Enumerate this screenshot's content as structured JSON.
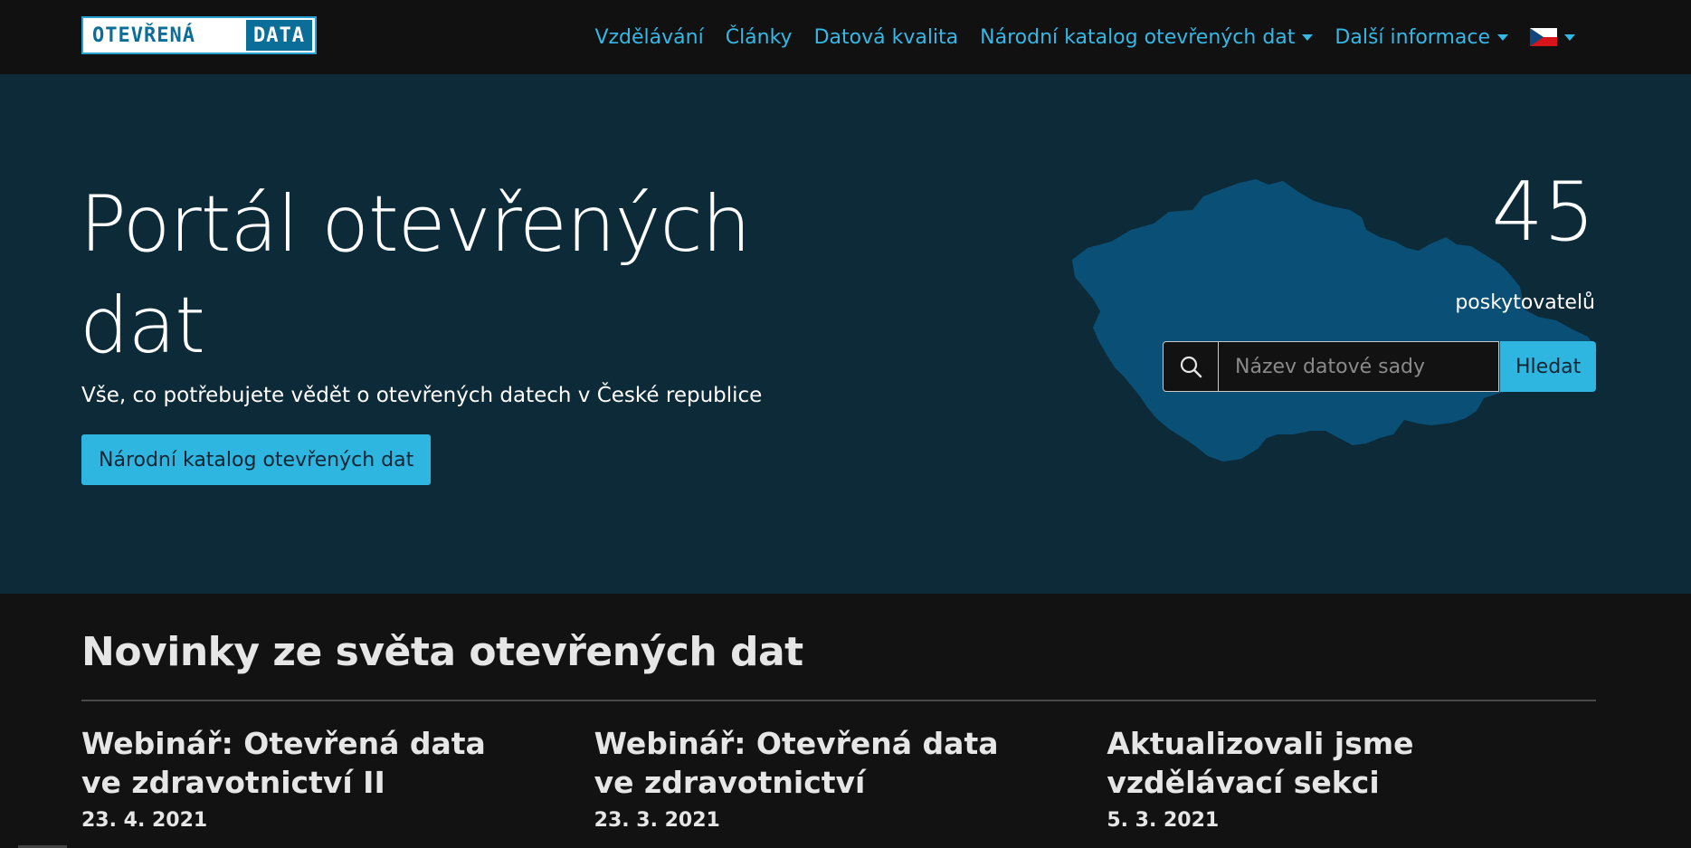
{
  "logo": {
    "part1": "OTEVŘENÁ",
    "part2": "DATA"
  },
  "nav": {
    "items": [
      {
        "label": "Vzdělávání",
        "dropdown": false
      },
      {
        "label": "Články",
        "dropdown": false
      },
      {
        "label": "Datová kvalita",
        "dropdown": false
      },
      {
        "label": "Národní katalog otevřených dat",
        "dropdown": true
      },
      {
        "label": "Další informace",
        "dropdown": true
      }
    ],
    "language_icon": "czech-flag-icon"
  },
  "hero": {
    "title": "Portál otevřených dat",
    "subtitle": "Vše, co potřebujete vědět o otevřených datech v České republice",
    "button_label": "Národní katalog otevřených dat",
    "providers_count": "45",
    "providers_label": "poskytovatelů",
    "search": {
      "placeholder": "Název datové sady",
      "button_label": "Hledat",
      "icon": "search-icon"
    }
  },
  "news": {
    "heading": "Novinky ze světa otevřených dat",
    "items": [
      {
        "title": "Webinář: Otevřená data ve zdravotnictví II",
        "date": "23. 4. 2021"
      },
      {
        "title": "Webinář: Otevřená data ve zdravotnictví",
        "date": "23. 3. 2021"
      },
      {
        "title": "Aktualizovali jsme vzdělávací sekci",
        "date": "5. 3. 2021"
      }
    ]
  },
  "colors": {
    "accent": "#2eb5e0",
    "nav_link": "#35b8e6",
    "hero_bg": "#0d2a38",
    "map_fill": "#0a4f75",
    "page_bg": "#121212"
  }
}
